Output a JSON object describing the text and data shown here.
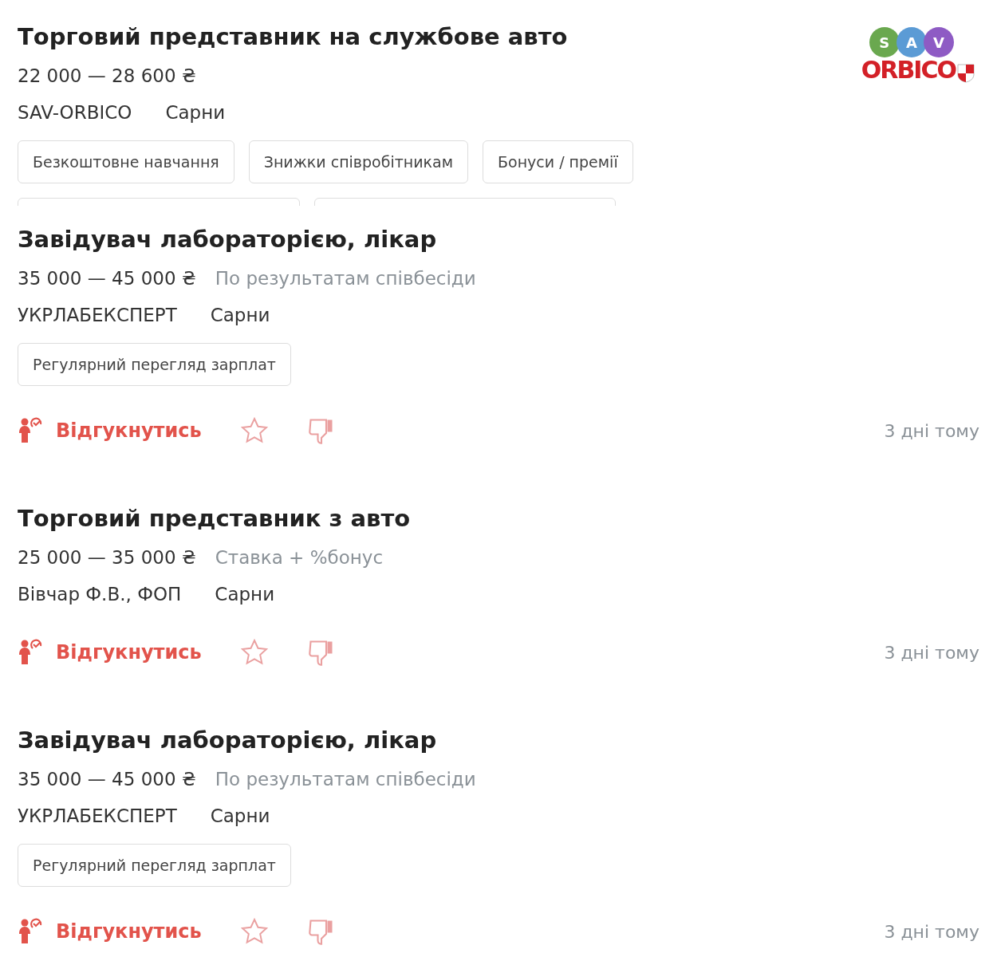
{
  "vacancies": [
    {
      "title": "Торговий представник на службове авто",
      "salary": "22 000 — 28 600 ₴",
      "company": "SAV-ORBICO",
      "city": "Сарни",
      "logo": {
        "circles": [
          {
            "letter": "S",
            "color": "#6aa84f"
          },
          {
            "letter": "A",
            "color": "#5b9bd5"
          },
          {
            "letter": "V",
            "color": "#8e5bc4"
          }
        ],
        "wordmark": "ORBICO"
      },
      "tags": [
        "Безкоштовне навчання",
        "Знижки співробітникам",
        "Бонуси / премії"
      ],
      "clipped": true
    },
    {
      "title": "Завідувач лабораторією, лікар",
      "salary": "35 000 — 45 000 ₴",
      "salary_note": "По результатам співбесіди",
      "company": "УКРЛАБЕКСПЕРТ",
      "city": "Сарни",
      "tags": [
        "Регулярний перегляд зарплат"
      ],
      "apply": "Відгукнутись",
      "date": "3 дні тому"
    },
    {
      "title": "Торговий представник з авто",
      "salary": "25 000 — 35 000 ₴",
      "salary_note": "Ставка + %бонус",
      "company": "Вівчар Ф.В., ФОП",
      "city": "Сарни",
      "apply": "Відгукнутись",
      "date": "3 дні тому"
    },
    {
      "title": "Завідувач лабораторією, лікар",
      "salary": "35 000 — 45 000 ₴",
      "salary_note": "По результатам співбесіди",
      "company": "УКРЛАБЕКСПЕРТ",
      "city": "Сарни",
      "tags": [
        "Регулярний перегляд зарплат"
      ],
      "apply": "Відгукнутись",
      "date": "3 дні тому"
    }
  ]
}
